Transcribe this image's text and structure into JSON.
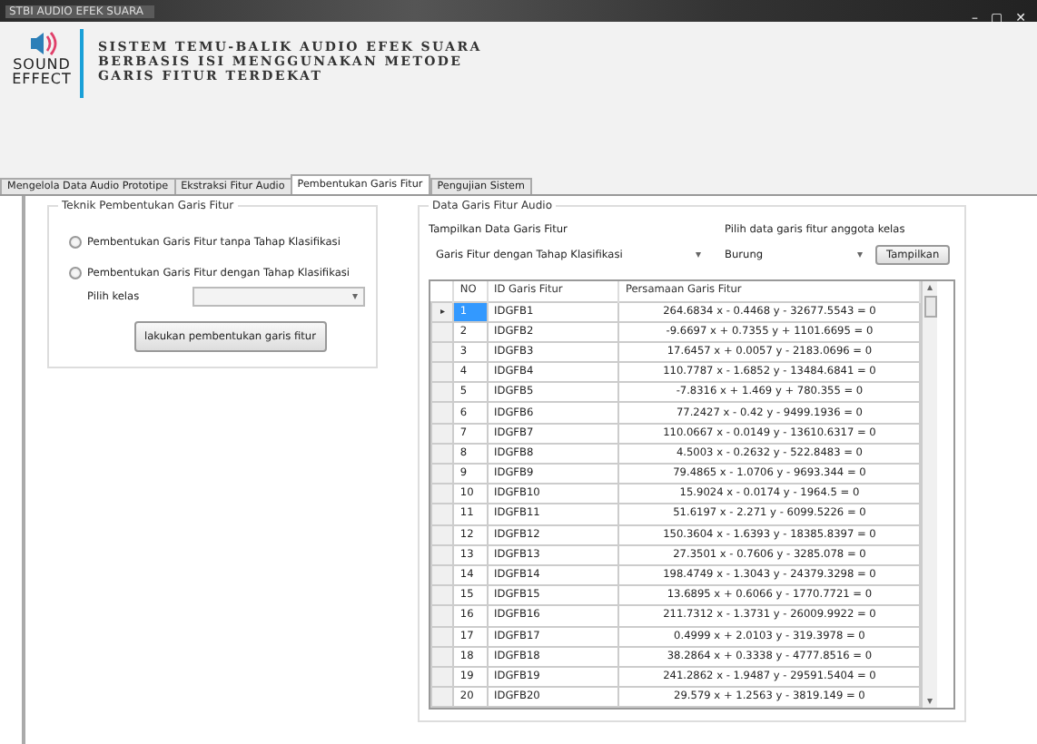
{
  "window": {
    "title": "STBI AUDIO EFEK SUARA",
    "controls": [
      "–",
      "▢",
      "✕"
    ]
  },
  "header": {
    "logo_top": "SOUND",
    "logo_bottom": "EFFECT",
    "title_lines": [
      "SISTEM TEMU-BALIK AUDIO EFEK SUARA",
      "BERBASIS ISI MENGGUNAKAN METODE",
      "GARIS FITUR TERDEKAT"
    ]
  },
  "tabs": [
    {
      "label": "Mengelola Data Audio Prototipe",
      "selected": false
    },
    {
      "label": "Ekstraksi Fitur Audio",
      "selected": false
    },
    {
      "label": "Pembentukan Garis Fitur",
      "selected": true
    },
    {
      "label": "Pengujian Sistem",
      "selected": false
    }
  ],
  "technique_group": {
    "title": "Teknik Pembentukan Garis Fitur",
    "options": [
      {
        "label": "Pembentukan Garis Fitur tanpa Tahap Klasifikasi",
        "checked": false
      },
      {
        "label": "Pembentukan Garis Fitur dengan Tahap Klasifikasi",
        "checked": false
      }
    ],
    "class_label": "Pilih kelas",
    "class_arrow": "▾",
    "button": "lakukan pembentukan garis fitur"
  },
  "data_group": {
    "title": "Data Garis Fitur Audio",
    "show_label": "Tampilkan Data Garis Fitur",
    "show_value": "Garis Fitur dengan Tahap Klasifikasi",
    "member_label": "Pilih data garis fitur anggota kelas",
    "member_value": "Burung",
    "arrow": "▾",
    "button": "Tampilkan",
    "table": {
      "columns": [
        "NO",
        "ID Garis Fitur",
        "Persamaan Garis Fitur"
      ],
      "row_marker": "▸",
      "rows": [
        {
          "cells": [
            "1",
            "IDGFB1",
            "264.6834 x - 0.4468 y - 32677.5543 = 0"
          ],
          "selected": true
        },
        {
          "cells": [
            "2",
            "IDGFB2",
            "-9.6697 x + 0.7355 y + 1101.6695 = 0"
          ],
          "selected": false
        },
        {
          "cells": [
            "3",
            "IDGFB3",
            "17.6457 x + 0.0057 y - 2183.0696 = 0"
          ],
          "selected": false
        },
        {
          "cells": [
            "4",
            "IDGFB4",
            "110.7787 x - 1.6852 y - 13484.6841 = 0"
          ],
          "selected": false
        },
        {
          "cells": [
            "5",
            "IDGFB5",
            "-7.8316 x + 1.469 y + 780.355 = 0"
          ],
          "selected": false
        },
        {
          "cells": [
            "6",
            "IDGFB6",
            "77.2427 x - 0.42 y - 9499.1936 = 0"
          ],
          "selected": false
        },
        {
          "cells": [
            "7",
            "IDGFB7",
            "110.0667 x - 0.0149 y - 13610.6317 = 0"
          ],
          "selected": false
        },
        {
          "cells": [
            "8",
            "IDGFB8",
            "4.5003 x - 0.2632 y - 522.8483 = 0"
          ],
          "selected": false
        },
        {
          "cells": [
            "9",
            "IDGFB9",
            "79.4865 x - 1.0706 y - 9693.344 = 0"
          ],
          "selected": false
        },
        {
          "cells": [
            "10",
            "IDGFB10",
            "15.9024 x - 0.0174 y - 1964.5 = 0"
          ],
          "selected": false
        },
        {
          "cells": [
            "11",
            "IDGFB11",
            "51.6197 x - 2.271 y - 6099.5226 = 0"
          ],
          "selected": false
        },
        {
          "cells": [
            "12",
            "IDGFB12",
            "150.3604 x - 1.6393 y - 18385.8397 = 0"
          ],
          "selected": false
        },
        {
          "cells": [
            "13",
            "IDGFB13",
            "27.3501 x - 0.7606 y - 3285.078 = 0"
          ],
          "selected": false
        },
        {
          "cells": [
            "14",
            "IDGFB14",
            "198.4749 x - 1.3043 y - 24379.3298 = 0"
          ],
          "selected": false
        },
        {
          "cells": [
            "15",
            "IDGFB15",
            "13.6895 x + 0.6066 y - 1770.7721 = 0"
          ],
          "selected": false
        },
        {
          "cells": [
            "16",
            "IDGFB16",
            "211.7312 x - 1.3731 y - 26009.9922 = 0"
          ],
          "selected": false
        },
        {
          "cells": [
            "17",
            "IDGFB17",
            "0.4999 x + 2.0103 y - 319.3978 = 0"
          ],
          "selected": false
        },
        {
          "cells": [
            "18",
            "IDGFB18",
            "38.2864 x + 0.3338 y - 4777.8516 = 0"
          ],
          "selected": false
        },
        {
          "cells": [
            "19",
            "IDGFB19",
            "241.2862 x - 1.9487 y - 29591.5404 = 0"
          ],
          "selected": false
        },
        {
          "cells": [
            "20",
            "IDGFB20",
            "29.579 x + 1.2563 y - 3819.149 = 0"
          ],
          "selected": false
        }
      ],
      "scroll_up": "▴",
      "scroll_down": "▾"
    }
  }
}
